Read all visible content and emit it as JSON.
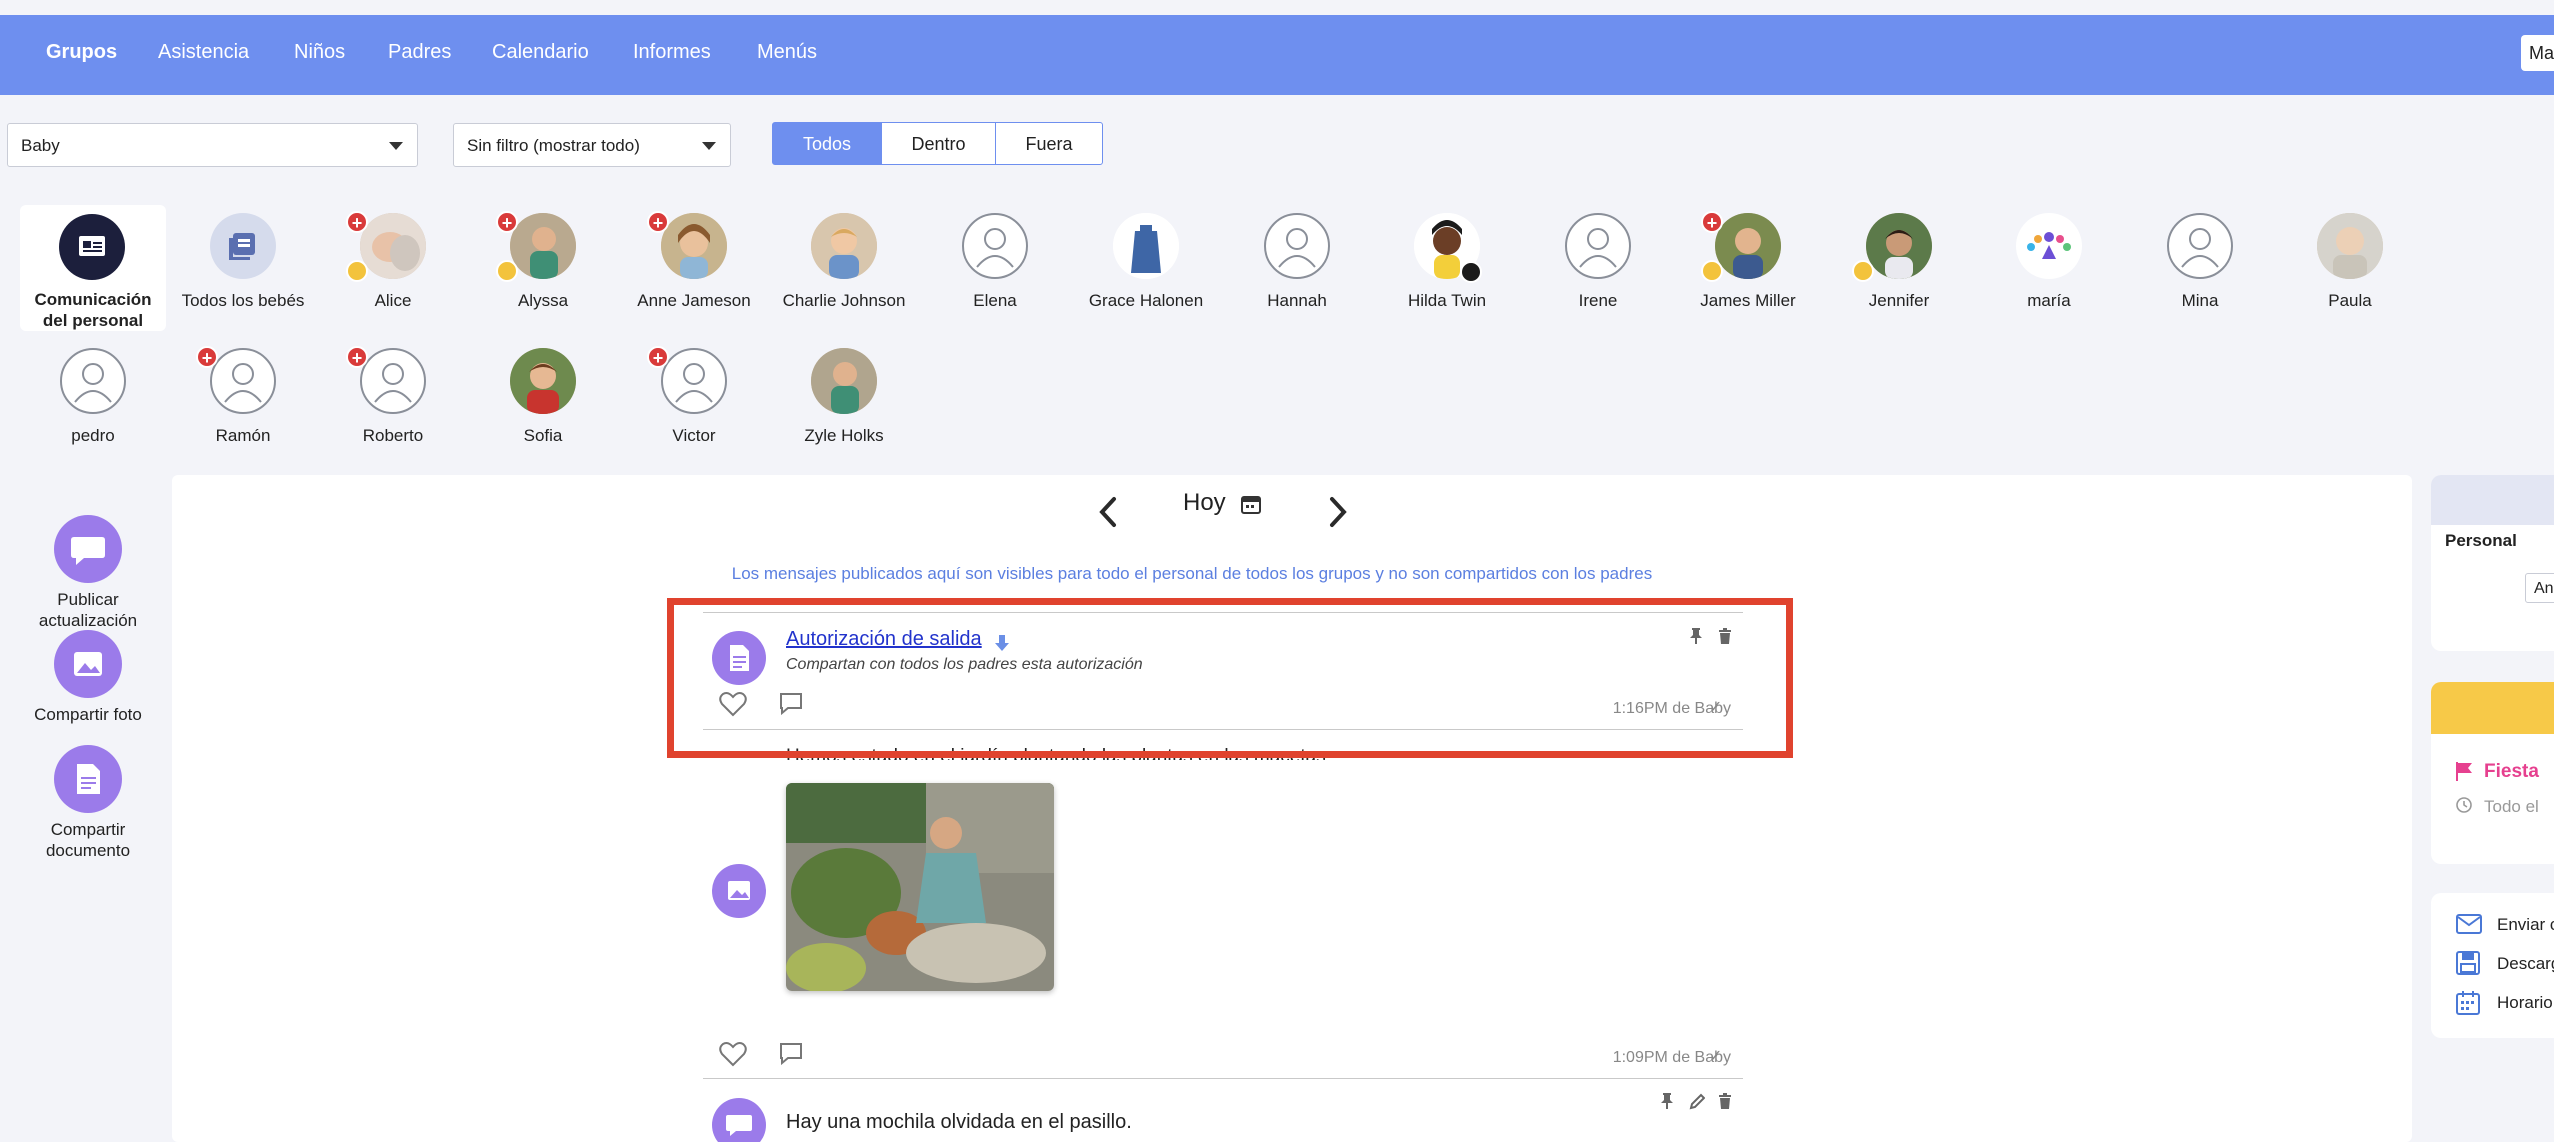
{
  "nav": {
    "items": [
      "Grupos",
      "Asistencia",
      "Niños",
      "Padres",
      "Calendario",
      "Informes",
      "Menús"
    ],
    "user_short": "Ma"
  },
  "filters": {
    "group": "Baby",
    "filter": "Sin filtro (mostrar todo)",
    "segments": [
      "Todos",
      "Dentro",
      "Fuera"
    ]
  },
  "children": {
    "staff": "Comunicación del personal",
    "all": "Todos los bebés",
    "names": [
      "Alice",
      "Alyssa",
      "Anne Jameson",
      "Charlie Johnson",
      "Elena",
      "Grace Halonen",
      "Hannah",
      "Hilda Twin",
      "Irene",
      "James Miller",
      "Jennifer",
      "maría",
      "Mina",
      "Paula",
      "pedro",
      "Ramón",
      "Roberto",
      "Sofia",
      "Victor",
      "Zyle Holks"
    ]
  },
  "actions": {
    "publish": "Publicar actualización",
    "photo": "Compartir foto",
    "document": "Compartir documento"
  },
  "feed": {
    "date": "Hoy",
    "notice": "Los mensajes publicados aquí son visibles para todo el personal de todos los grupos y no son compartidos con los padres",
    "posts": [
      {
        "title": "Autorización de salida",
        "subtitle": "Compartan con todos los padres esta autorización",
        "meta": "1:16PM de Baby"
      },
      {
        "text": "Hemos estado en el jardín plantando las plantas en las macetas",
        "meta": "1:09PM de Baby"
      },
      {
        "text": "Hay una mochila olvidada en el pasillo."
      }
    ]
  },
  "sidebar": {
    "staff_label": "Personal",
    "staff_select": "An",
    "event_title": "Fiesta",
    "event_time": "Todo el",
    "links": [
      "Enviar c",
      "Descarg",
      "Horario"
    ]
  },
  "colors": {
    "nav": "#6e8fef",
    "accent_purple": "#9b7bea",
    "highlight": "#e0432e",
    "event_bar": "#f7c948",
    "event_pink": "#e6408f"
  }
}
